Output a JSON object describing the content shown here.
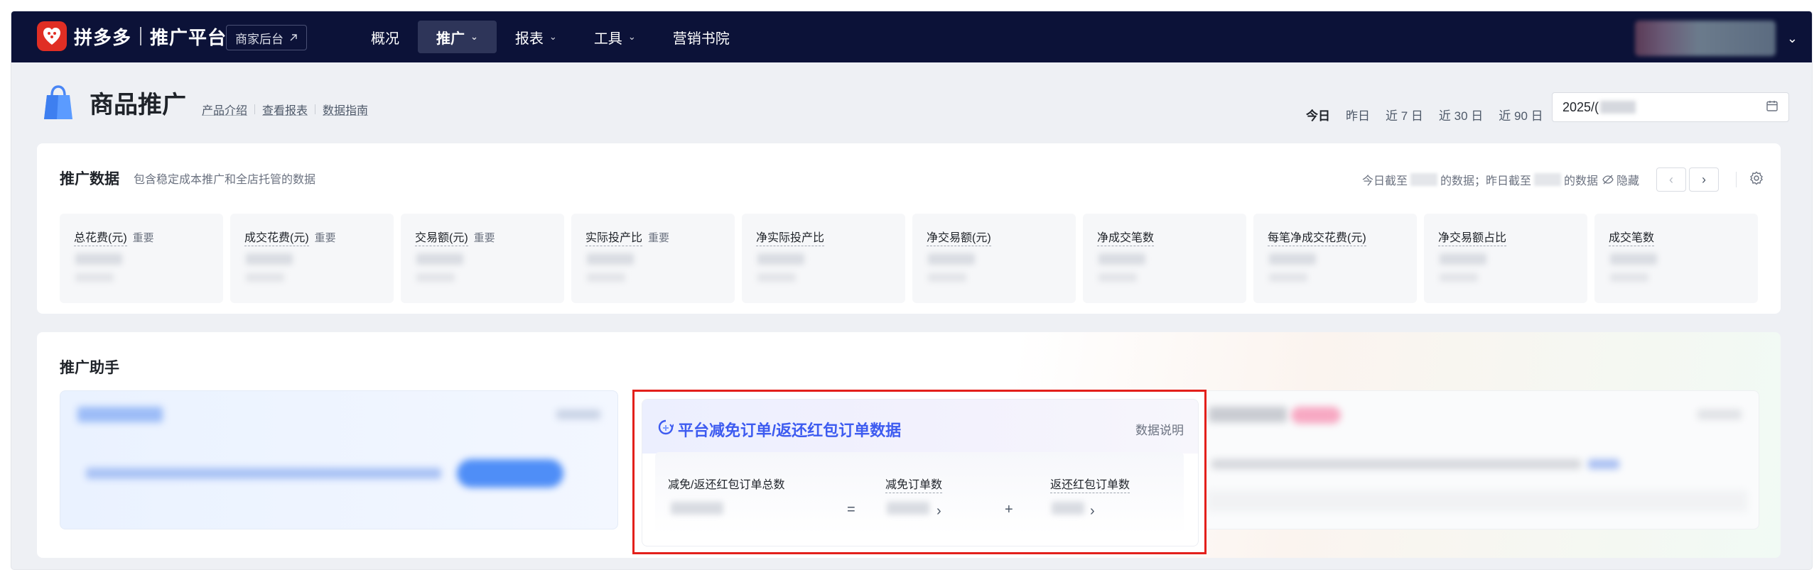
{
  "topbar": {
    "brand": "拼多多",
    "platform": "推广平台",
    "merchant_btn": "商家后台",
    "nav": [
      {
        "label": "概况",
        "active": false,
        "dropdown": false
      },
      {
        "label": "推广",
        "active": true,
        "dropdown": true
      },
      {
        "label": "报表",
        "active": false,
        "dropdown": true
      },
      {
        "label": "工具",
        "active": false,
        "dropdown": true
      },
      {
        "label": "营销书院",
        "active": false,
        "dropdown": false
      }
    ]
  },
  "header": {
    "title": "商品推广",
    "links": [
      "产品介绍",
      "查看报表",
      "数据指南"
    ],
    "date_tabs": [
      "今日",
      "昨日",
      "近 7 日",
      "近 30 日",
      "近 90 日"
    ],
    "active_tab": "今日",
    "date_value": "2025/("
  },
  "data_card": {
    "title": "推广数据",
    "desc": "包含稳定成本推广和全店托管的数据",
    "asof_prefix": "今日截至",
    "asof_mid": "的数据；昨日截至",
    "asof_suffix": "的数据",
    "hide": "隐藏",
    "metrics": [
      {
        "label": "总花费(元)",
        "tag": "重要"
      },
      {
        "label": "成交花费(元)",
        "tag": "重要"
      },
      {
        "label": "交易额(元)",
        "tag": "重要"
      },
      {
        "label": "实际投产比",
        "tag": "重要"
      },
      {
        "label": "净实际投产比",
        "tag": ""
      },
      {
        "label": "净交易额(元)",
        "tag": ""
      },
      {
        "label": "净成交笔数",
        "tag": ""
      },
      {
        "label": "每笔净成交花费(元)",
        "tag": ""
      },
      {
        "label": "净交易额占比",
        "tag": ""
      },
      {
        "label": "成交笔数",
        "tag": ""
      }
    ]
  },
  "assistant": {
    "title": "推广助手",
    "center": {
      "title": "平台减免订单/返还红包订单数据",
      "explain": "数据说明",
      "col_total": "减免/返还红包订单总数",
      "op_eq": "=",
      "col_reduce": "减免订单数",
      "op_plus": "+",
      "col_refund": "返还红包订单数"
    }
  },
  "colors": {
    "topbar_bg": "#0c1238",
    "brand_red": "#e02e24",
    "accent_blue": "#3d5bf0",
    "highlight": "#e3201b"
  }
}
